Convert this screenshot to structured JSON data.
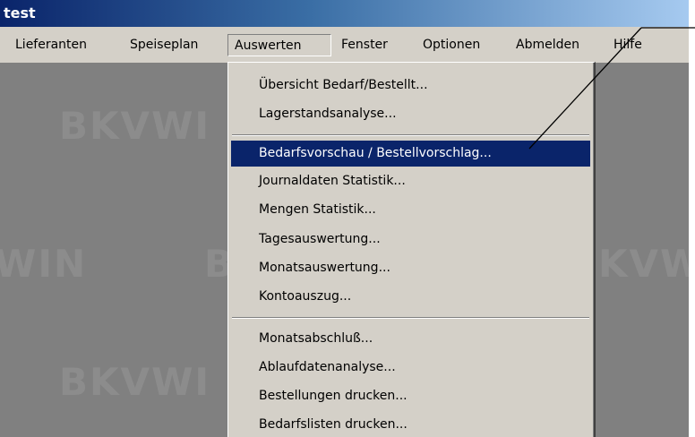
{
  "window": {
    "title": "test"
  },
  "menubar": {
    "items": [
      {
        "label": "Lieferanten",
        "open": false
      },
      {
        "label": "Speiseplan",
        "open": false
      },
      {
        "label": "Auswerten",
        "open": true
      },
      {
        "label": "Fenster",
        "open": false
      },
      {
        "label": "Optionen",
        "open": false
      },
      {
        "label": "Abmelden",
        "open": false
      },
      {
        "label": "Hilfe",
        "open": false
      }
    ]
  },
  "dropdown": {
    "groups": [
      [
        "Übersicht Bedarf/Bestellt...",
        "Lagerstandsanalyse..."
      ],
      [
        "Bedarfsvorschau / Bestellvorschlag...",
        "Journaldaten Statistik...",
        "Mengen Statistik...",
        "Tagesauswertung...",
        "Monatsauswertung...",
        "Kontoauszug..."
      ],
      [
        "Monatsabschluß...",
        "Ablaufdatenanalyse...",
        "Bestellungen drucken...",
        "Bedarfslisten drucken..."
      ]
    ],
    "highlighted": "Bedarfsvorschau / Bestellvorschlag..."
  },
  "background": {
    "watermark_fragments": [
      "BKVWI",
      "WIN",
      "B",
      "KVW",
      "BKVWI"
    ]
  },
  "colors": {
    "highlight": "#0a246a",
    "menu_bg": "#d4d0c8",
    "desktop_bg": "#808080"
  }
}
